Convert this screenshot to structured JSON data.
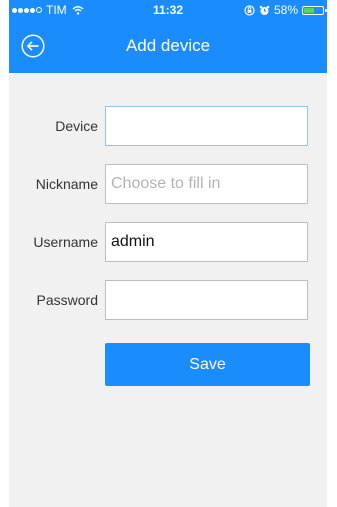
{
  "status_bar": {
    "carrier": "TIM",
    "time": "11:32",
    "battery": "58%",
    "battery_level": 0.58
  },
  "nav": {
    "title": "Add device",
    "back_icon": "back-arrow-circle-icon"
  },
  "form": {
    "device_label": "Device",
    "device_value": "",
    "nickname_label": "Nickname",
    "nickname_placeholder": "Choose to fill in",
    "username_label": "Username",
    "username_value": "admin",
    "password_label": "Password",
    "password_value": ""
  },
  "actions": {
    "save_label": "Save"
  },
  "colors": {
    "header": "#1a8cfc",
    "button": "#1a8cfc",
    "background": "#f1f1f2",
    "battery": "#4cd964"
  }
}
